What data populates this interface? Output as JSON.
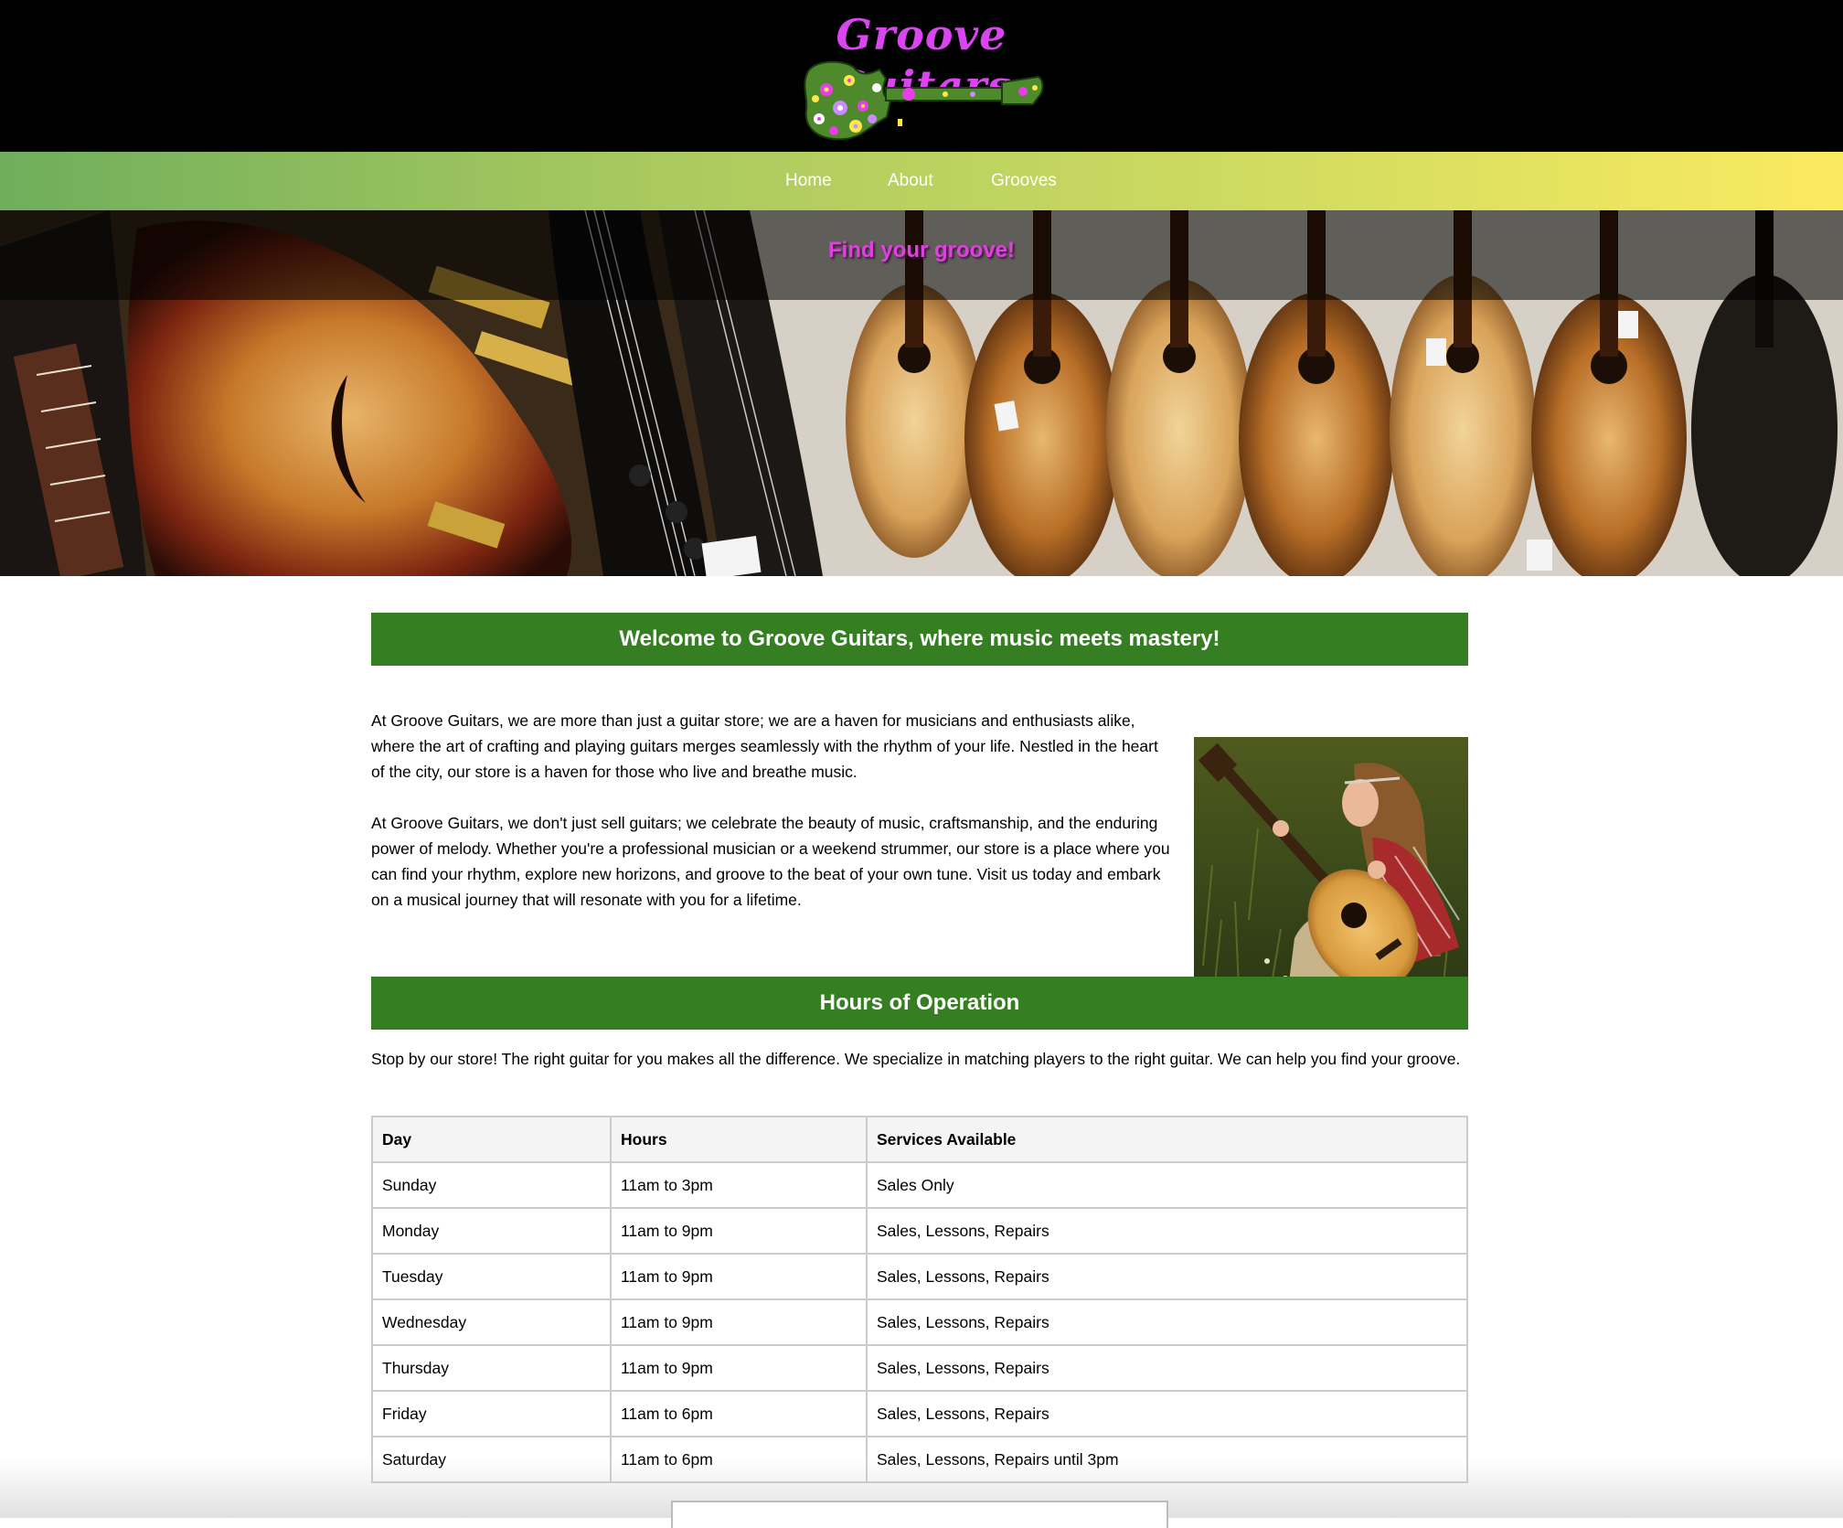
{
  "header": {
    "logo_text": "Groove Guitars",
    "logo_color": "#d946ef"
  },
  "nav": {
    "items": [
      {
        "label": "Home"
      },
      {
        "label": "About"
      },
      {
        "label": "Grooves"
      }
    ]
  },
  "hero": {
    "tagline": "Find your groove!"
  },
  "welcome": {
    "heading": "Welcome to Groove Guitars, where music meets mastery!",
    "paragraphs": [
      "At Groove Guitars, we are more than just a guitar store; we are a haven for musicians and enthusiasts alike, where the art of crafting and playing guitars merges seamlessly with the rhythm of your life. Nestled in the heart of the city, our store is a haven for those who live and breathe music.",
      "At Groove Guitars, we don't just sell guitars; we celebrate the beauty of music, craftsmanship, and the enduring power of melody. Whether you're a professional musician or a weekend strummer, our store is a place where you can find your rhythm, explore new horizons, and groove to the beat of your own tune. Visit us today and embark on a musical journey that will resonate with you for a lifetime."
    ]
  },
  "hours": {
    "heading": "Hours of Operation",
    "intro": "Stop by our store! The right guitar for you makes all the difference. We specialize in matching players to the right guitar. We can help you find your groove.",
    "columns": [
      "Day",
      "Hours",
      "Services Available"
    ],
    "rows": [
      [
        "Sunday",
        "11am to 3pm",
        "Sales Only"
      ],
      [
        "Monday",
        "11am to 9pm",
        "Sales, Lessons, Repairs"
      ],
      [
        "Tuesday",
        "11am to 9pm",
        "Sales, Lessons, Repairs"
      ],
      [
        "Wednesday",
        "11am to 9pm",
        "Sales, Lessons, Repairs"
      ],
      [
        "Thursday",
        "11am to 9pm",
        "Sales, Lessons, Repairs"
      ],
      [
        "Friday",
        "11am to 6pm",
        "Sales, Lessons, Repairs"
      ],
      [
        "Saturday",
        "11am to 6pm",
        "Sales, Lessons, Repairs until 3pm"
      ]
    ]
  },
  "colors": {
    "header_bg": "#000000",
    "section_green": "#357f22",
    "nav_gradient_start": "#6fae5c",
    "nav_gradient_end": "#fbea60",
    "tagline": "#e040e0"
  },
  "icons": {
    "logo": "floral-guitar-logo",
    "hero": "guitar-store-photo",
    "photo": "girl-with-acoustic-guitar-photo"
  }
}
